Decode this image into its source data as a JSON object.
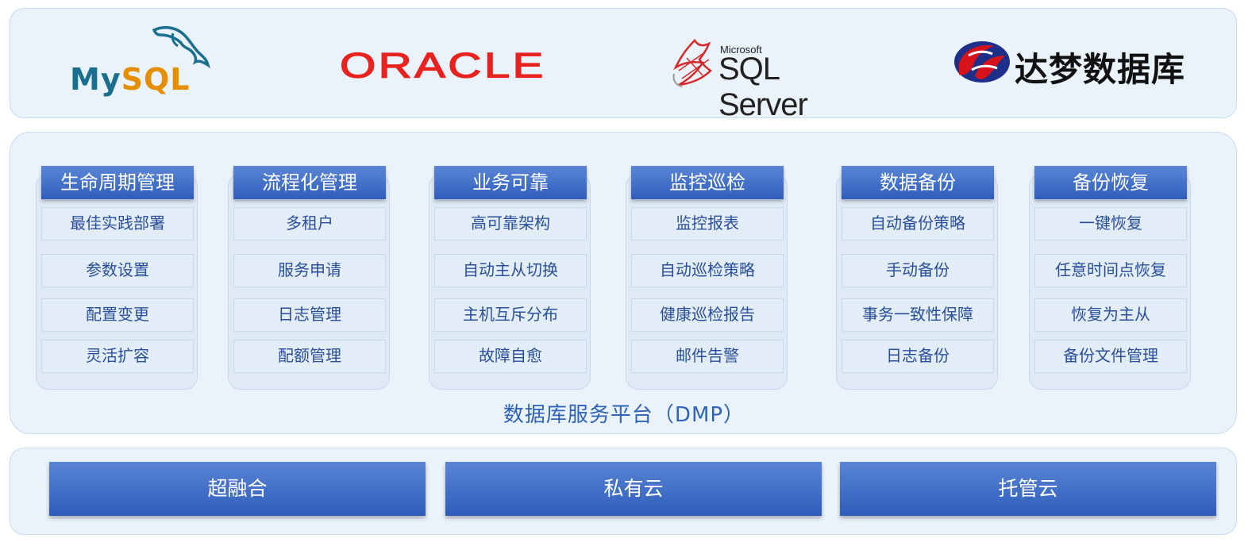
{
  "databases": {
    "mysql": {
      "my": "My",
      "sql": "SQL"
    },
    "oracle": "ORACLE",
    "sqlserver": {
      "brand": "Microsoft",
      "name": "SQL Server"
    },
    "dameng": "达梦数据库"
  },
  "platform": {
    "title": "数据库服务平台（DMP）",
    "modules": [
      {
        "title": "生命周期管理",
        "items": [
          "最佳实践部署",
          "参数设置",
          "配置变更",
          "灵活扩容"
        ]
      },
      {
        "title": "流程化管理",
        "items": [
          "多租户",
          "服务申请",
          "日志管理",
          "配额管理"
        ]
      },
      {
        "title": "业务可靠",
        "items": [
          "高可靠架构",
          "自动主从切换",
          "主机互斥分布",
          "故障自愈"
        ]
      },
      {
        "title": "监控巡检",
        "items": [
          "监控报表",
          "自动巡检策略",
          "健康巡检报告",
          "邮件告警"
        ]
      },
      {
        "title": "数据备份",
        "items": [
          "自动备份策略",
          "手动备份",
          "事务一致性保障",
          "日志备份"
        ]
      },
      {
        "title": "备份恢复",
        "items": [
          "一键恢复",
          "任意时间点恢复",
          "恢复为主从",
          "备份文件管理"
        ]
      }
    ]
  },
  "infrastructure": [
    "超融合",
    "私有云",
    "托管云"
  ],
  "colors": {
    "header_blue": "#2f5dbb",
    "item_text": "#2a4f9a",
    "oracle_red": "#e8231f",
    "mysql_blue": "#1a6f8e",
    "mysql_orange": "#e48e00",
    "dameng_red": "#d7121a",
    "dameng_blue": "#1e2f8a"
  }
}
